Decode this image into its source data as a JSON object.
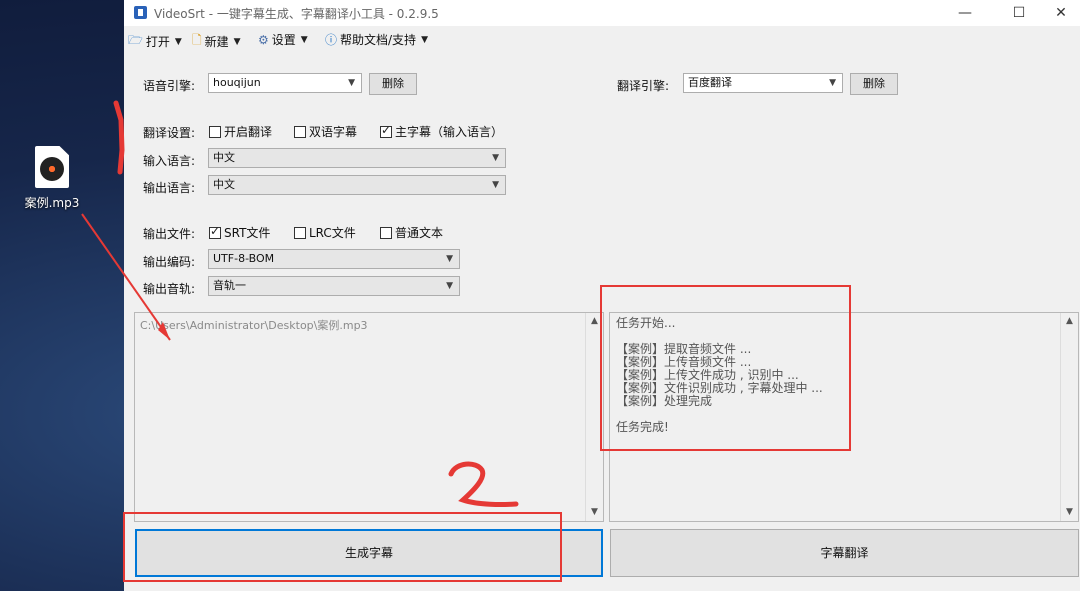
{
  "desktop": {
    "file_label": "案例.mp3"
  },
  "window": {
    "title": "VideoSrt - 一键字幕生成、字幕翻译小工具 - 0.2.9.5"
  },
  "menu": [
    {
      "label": "打开"
    },
    {
      "label": "新建"
    },
    {
      "label": "设置"
    },
    {
      "label": "帮助文档/支持"
    }
  ],
  "speech": {
    "label": "语音引擎:",
    "value": "houqijun",
    "delete_label": "删除"
  },
  "translate_engine": {
    "label": "翻译引擎:",
    "value": "百度翻译",
    "delete_label": "删除"
  },
  "translate_settings": {
    "label": "翻译设置:",
    "options": [
      {
        "label": "开启翻译",
        "checked": false
      },
      {
        "label": "双语字幕",
        "checked": false
      },
      {
        "label": "主字幕（输入语言）",
        "checked": true
      }
    ]
  },
  "input_lang": {
    "label": "输入语言:",
    "value": "中文"
  },
  "output_lang": {
    "label": "输出语言:",
    "value": "中文"
  },
  "output_file": {
    "label": "输出文件:",
    "options": [
      {
        "label": "SRT文件",
        "checked": true
      },
      {
        "label": "LRC文件",
        "checked": false
      },
      {
        "label": "普通文本",
        "checked": false
      }
    ]
  },
  "output_encoding": {
    "label": "输出编码:",
    "value": "UTF-8-BOM"
  },
  "output_track": {
    "label": "输出音轨:",
    "value": "音轨一"
  },
  "file_path": "C:\\Users\\Administrator\\Desktop\\案例.mp3",
  "log": [
    "任务开始...",
    "",
    "【案例】提取音频文件 ...",
    "【案例】上传音频文件 ...",
    "【案例】上传文件成功 , 识别中 ...",
    "【案例】文件识别成功 , 字幕处理中 ...",
    "【案例】处理完成",
    "",
    "任务完成!"
  ],
  "buttons": {
    "generate": "生成字幕",
    "translate": "字幕翻译"
  },
  "annotations": {
    "step1": "1",
    "step2": "2",
    "color": "#e53935"
  }
}
